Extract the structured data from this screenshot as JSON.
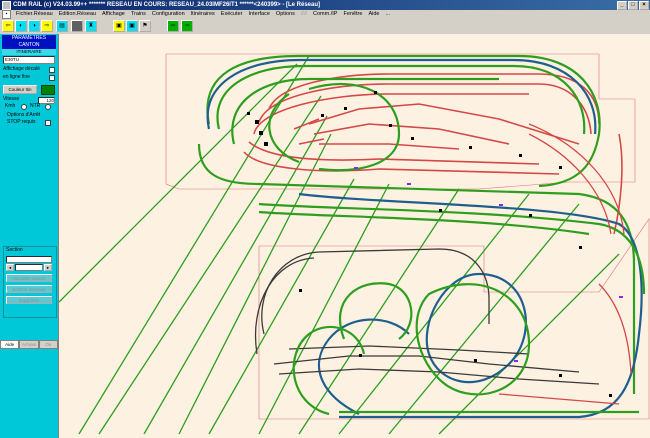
{
  "window": {
    "title": "CDM RAIL (c) V24.03.99++   ******* RESEAU EN COURS: RESEAU_24.03IMF26IT1 ******<240399> - [Le Réseau]"
  },
  "menu": {
    "items": [
      "Fichier.Réseau",
      "Edition.Réseau",
      "Affichage",
      "Trains",
      "Configuration",
      "Itinéraires",
      "Exécuter",
      "Interface",
      "Options",
      "////",
      "Comm./IP",
      "Fenêtre",
      "Aide",
      "..."
    ]
  },
  "panel": {
    "header": "PARAMETRES",
    "header2": "CANTON",
    "subheader": "ITINERAIRE",
    "canton_id": "E30TU",
    "affichage_decale": "Affichage décalé",
    "en_ligne_fine": "en ligne fine",
    "couleur_btn": "Couleur Itin",
    "vitesse_label": "Vitesse",
    "vitesse_value": "120",
    "kmh": "Kmh",
    "ntr": "NTR",
    "options_arret": "Options d'Arrêt",
    "stop_requis": "STOP requis",
    "section_label": "Section",
    "sec_btn1": "Nouvelle section",
    "sec_btn2": "Section inversée",
    "sec_btn3": "Supprimer",
    "tabs": [
      "Aide",
      "Armani",
      "On"
    ]
  },
  "colors": {
    "panel_bg": "#00c8d8",
    "canvas_bg": "#fdf2e2",
    "track_green": "#2e9e1e",
    "track_red": "#d44848",
    "track_blue": "#1f5f8f",
    "track_dark": "#3a3a3a"
  }
}
